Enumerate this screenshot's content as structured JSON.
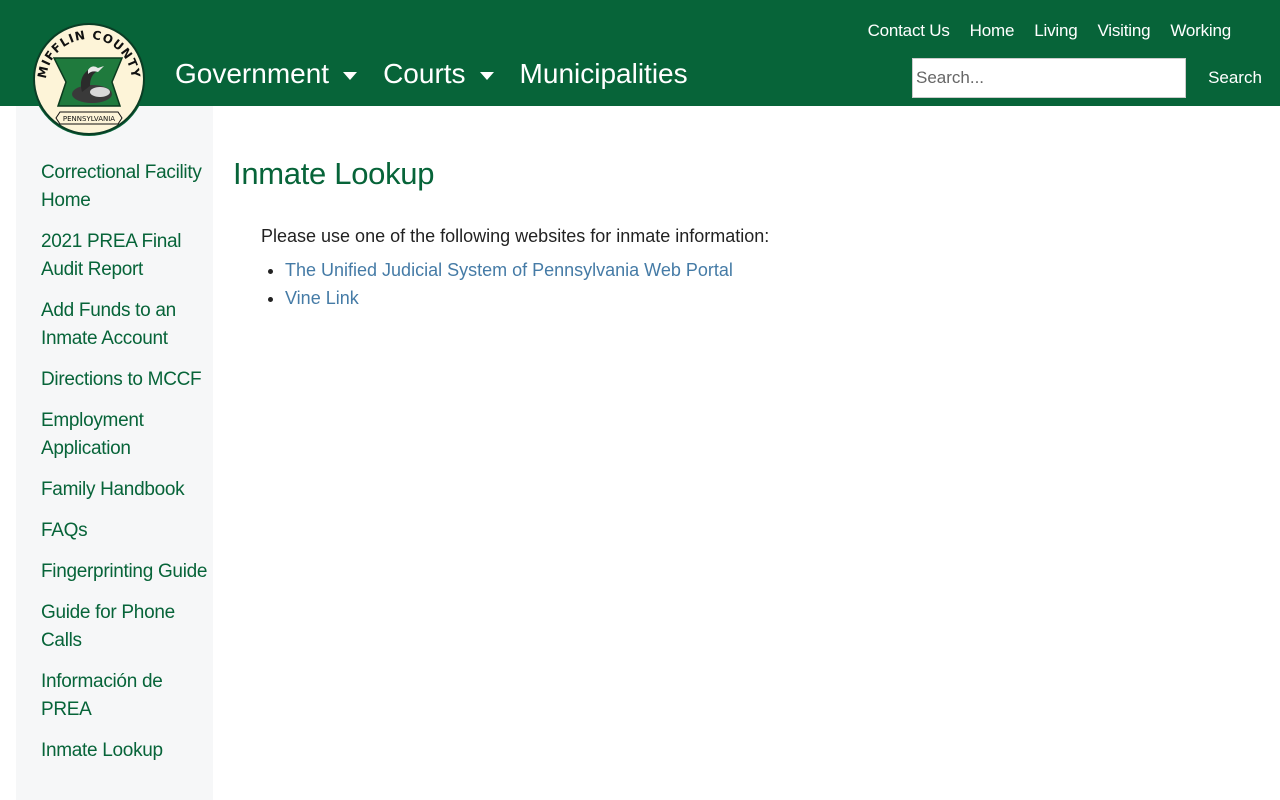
{
  "header": {
    "logo": {
      "arc_text": "MIFFLIN COUNTY",
      "banner_text": "PENNSYLVANIA"
    },
    "utility_nav": [
      {
        "label": "Contact Us"
      },
      {
        "label": "Home"
      },
      {
        "label": "Living"
      },
      {
        "label": "Visiting"
      },
      {
        "label": "Working"
      }
    ],
    "main_nav": [
      {
        "label": "Government"
      },
      {
        "label": "Courts"
      },
      {
        "label": "Municipalities"
      }
    ],
    "search": {
      "placeholder": "Search...",
      "button_label": "Search"
    }
  },
  "sidebar": {
    "items": [
      {
        "label": "Correctional Facility Home"
      },
      {
        "label": "2021 PREA Final Audit Report"
      },
      {
        "label": "Add Funds to an Inmate Account"
      },
      {
        "label": "Directions to MCCF"
      },
      {
        "label": "Employment Application"
      },
      {
        "label": "Family Handbook"
      },
      {
        "label": "FAQs"
      },
      {
        "label": "Fingerprinting Guide"
      },
      {
        "label": "Guide for Phone Calls"
      },
      {
        "label": "Información de PREA"
      },
      {
        "label": "Inmate Lookup"
      }
    ]
  },
  "main": {
    "title": "Inmate Lookup",
    "intro": "Please use one of the following websites for inmate information:",
    "links": [
      {
        "label": "The Unified Judicial System of Pennsylvania Web Portal"
      },
      {
        "label": "Vine Link"
      }
    ]
  },
  "colors": {
    "brand_green": "#076439",
    "link_blue": "#457ba6",
    "sidebar_bg": "#f6f7f8"
  }
}
